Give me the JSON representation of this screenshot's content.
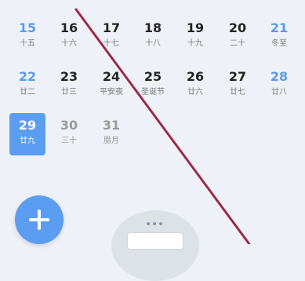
{
  "calendar": {
    "rows": [
      [
        {
          "day": "15",
          "sub": "十五",
          "style": "weekend"
        },
        {
          "day": "16",
          "sub": "十六",
          "style": ""
        },
        {
          "day": "17",
          "sub": "十七",
          "style": ""
        },
        {
          "day": "18",
          "sub": "十八",
          "style": ""
        },
        {
          "day": "19",
          "sub": "十九",
          "style": ""
        },
        {
          "day": "20",
          "sub": "二十",
          "style": ""
        },
        {
          "day": "21",
          "sub": "冬至",
          "style": "weekend"
        }
      ],
      [
        {
          "day": "22",
          "sub": "廿二",
          "style": "weekend"
        },
        {
          "day": "23",
          "sub": "廿三",
          "style": ""
        },
        {
          "day": "24",
          "sub": "平安夜",
          "style": ""
        },
        {
          "day": "25",
          "sub": "圣诞节",
          "style": ""
        },
        {
          "day": "26",
          "sub": "廿六",
          "style": ""
        },
        {
          "day": "27",
          "sub": "廿七",
          "style": ""
        },
        {
          "day": "28",
          "sub": "廿八",
          "style": "weekend"
        }
      ],
      [
        {
          "day": "29",
          "sub": "廿九",
          "style": "selected"
        },
        {
          "day": "30",
          "sub": "三十",
          "style": "muted"
        },
        {
          "day": "31",
          "sub": "腊月",
          "style": "muted"
        }
      ]
    ]
  },
  "fab": {
    "icon": "plus-icon"
  },
  "colors": {
    "accent": "#5b9df0",
    "weekend_text": "#5a9ce8",
    "annotation_line": "#9b2b45"
  }
}
